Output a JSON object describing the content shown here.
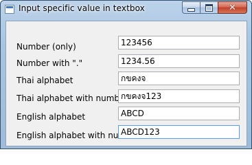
{
  "window": {
    "title": "Input specific value in textbox",
    "icon": "form-icon",
    "caption_buttons": [
      "minimize-icon",
      "maximize-icon",
      "close-icon"
    ],
    "close_glyph": "✕"
  },
  "form": {
    "rows": [
      {
        "label": "Number (only)",
        "value": "123456"
      },
      {
        "label": "Number with \".\"",
        "value": "1234.56"
      },
      {
        "label": "Thai alphabet",
        "value": "กขคงจ"
      },
      {
        "label": "Thai alphabet with number",
        "value": "กขคงจ123"
      },
      {
        "label": "English alphabet",
        "value": "ABCD"
      },
      {
        "label": "English alphabet with number",
        "value": "ABCD123"
      }
    ],
    "focused_row": 5
  },
  "colors": {
    "title_bar": "#a9c4e0",
    "client_background": "#f0f0f0",
    "focus_border": "#569de5",
    "close_button": "#c1402a"
  }
}
